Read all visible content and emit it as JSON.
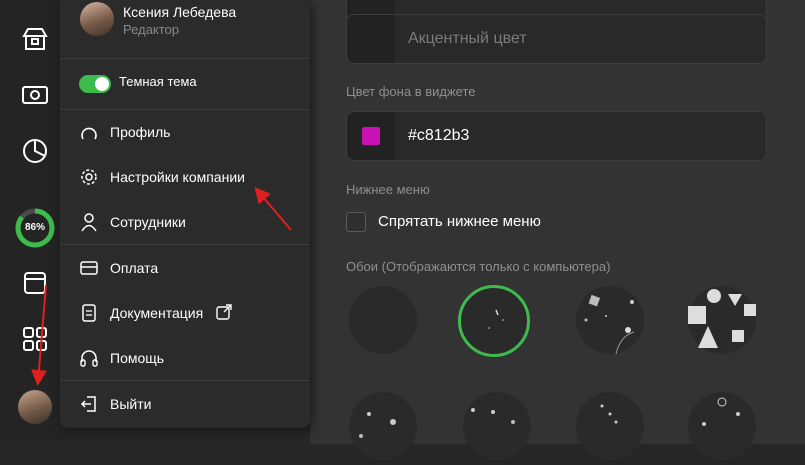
{
  "rail": {
    "progress": {
      "value_label": "86%",
      "fraction": 0.86
    }
  },
  "user": {
    "name": "Ксения Лебедева",
    "role": "Редактор"
  },
  "menu": {
    "dark_theme": {
      "label": "Темная тема",
      "enabled": true
    },
    "items": [
      {
        "label": "Профиль",
        "icon": "profile-icon"
      },
      {
        "label": "Настройки компании",
        "icon": "gear-icon"
      },
      {
        "label": "Сотрудники",
        "icon": "employees-icon"
      },
      {
        "label": "Оплата",
        "icon": "card-icon"
      },
      {
        "label": "Документация",
        "icon": "document-icon"
      },
      {
        "label": "Помощь",
        "icon": "headphones-icon"
      },
      {
        "label": "Выйти",
        "icon": "logout-icon"
      }
    ]
  },
  "settings": {
    "accent_field": {
      "placeholder": "Акцентный цвет"
    },
    "widget_bg": {
      "label": "Цвет фона в виджете",
      "value": "#c812b3",
      "color": "#c812b3"
    },
    "bottom_menu": {
      "label": "Нижнее меню",
      "checkbox_label": "Спрятать нижнее меню",
      "checked": false
    },
    "wallpapers": {
      "label": "Обои (Отображаются только с компьютера)"
    }
  },
  "colors": {
    "accent_green": "#3dbb4d",
    "annotation_red": "#e02020"
  }
}
